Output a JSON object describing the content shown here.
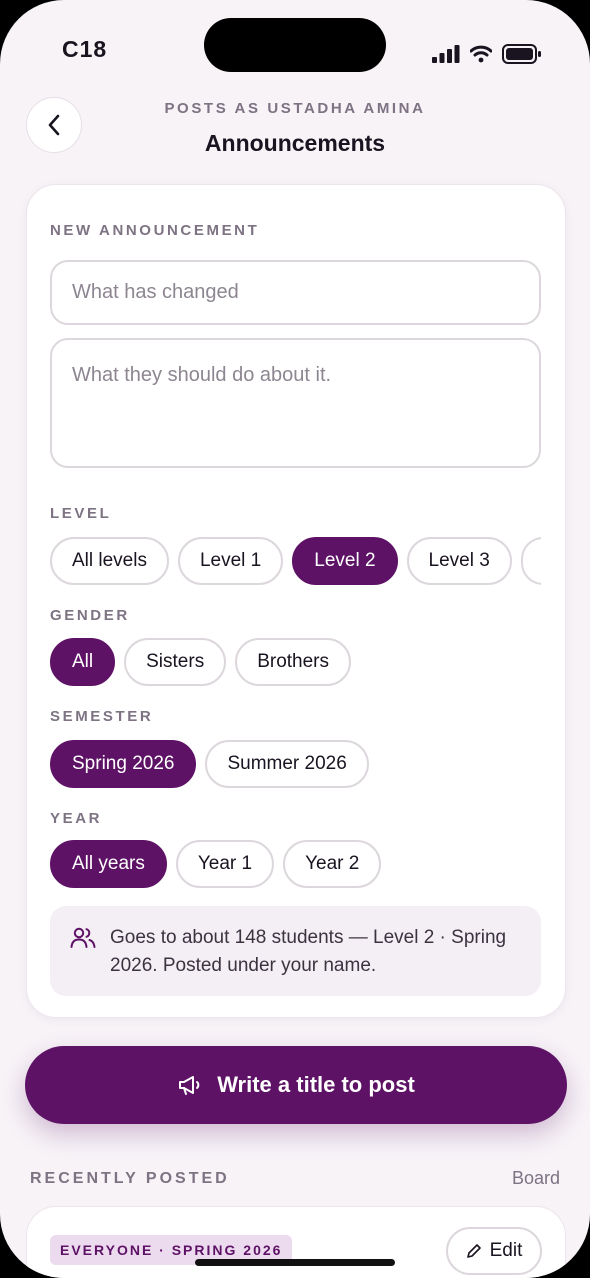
{
  "status_bar": {
    "time": "C18"
  },
  "header": {
    "subtitle": "POSTS AS USTADHA AMINA",
    "title": "Announcements"
  },
  "form": {
    "section_label": "NEW ANNOUNCEMENT",
    "title_placeholder": "What has changed",
    "body_placeholder": "What they should do about it.",
    "level": {
      "label": "LEVEL",
      "options": [
        "All levels",
        "Level 1",
        "Level 2",
        "Level 3",
        ""
      ],
      "selected": "Level 2"
    },
    "gender": {
      "label": "GENDER",
      "options": [
        "All",
        "Sisters",
        "Brothers"
      ],
      "selected": "All"
    },
    "semester": {
      "label": "SEMESTER",
      "options": [
        "Spring 2026",
        "Summer 2026"
      ],
      "selected": "Spring 2026"
    },
    "year": {
      "label": "YEAR",
      "options": [
        "All years",
        "Year 1",
        "Year 2"
      ],
      "selected": "All years"
    },
    "audience_info": "Goes to about 148 students — Level 2 · Spring 2026. Posted under your name."
  },
  "post_button_label": "Write a title to post",
  "recent": {
    "label": "RECENTLY POSTED",
    "board_link": "Board",
    "items": [
      {
        "audience": "EVERYONE · SPRING 2026",
        "edit_label": "Edit"
      }
    ]
  },
  "colors": {
    "accent": "#5e1266",
    "background": "#f7f3f7",
    "muted": "#7d7383"
  }
}
